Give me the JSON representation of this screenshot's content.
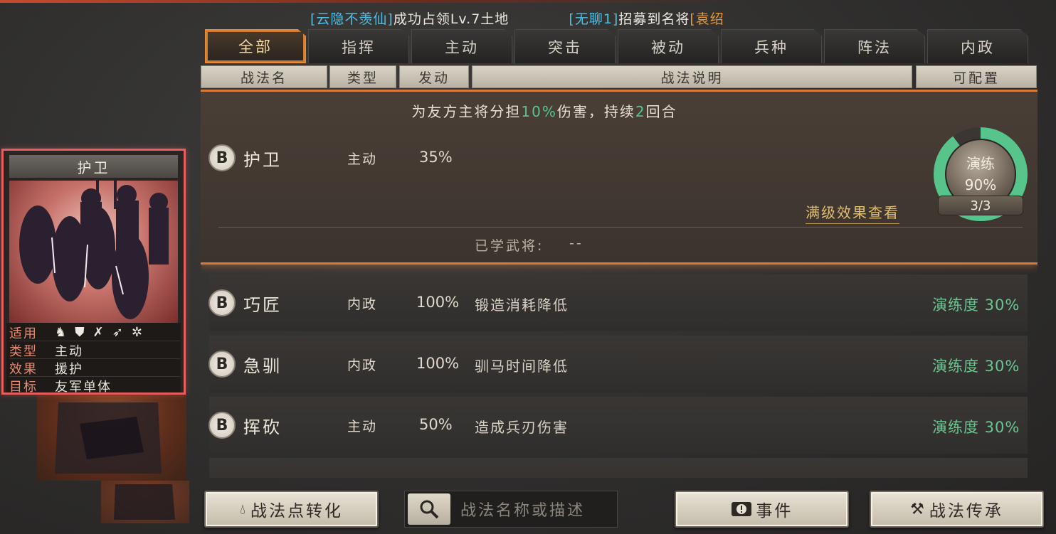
{
  "marquee": {
    "part1_name": "[云隐不羡仙]",
    "part1_text": "成功占领Lv.7土地",
    "part2_name": "[无聊1]",
    "part2_text": "招募到名将",
    "part2_hero": "[袁绍"
  },
  "tabs": [
    "全部",
    "指挥",
    "主动",
    "突击",
    "被动",
    "兵种",
    "阵法",
    "内政"
  ],
  "columns": {
    "name": "战法名",
    "type": "类型",
    "trigger": "发动",
    "desc": "战法说明",
    "configurable": "可配置"
  },
  "selected": {
    "grade": "B",
    "name": "护卫",
    "type": "主动",
    "trigger": "35%",
    "desc_pre": "为友方主将分担",
    "desc_pct": "10%",
    "desc_mid": "伤害，持续",
    "desc_num": "2",
    "desc_post": "回合",
    "full_effect_link": "满级效果查看",
    "learned_label": "已学武将:",
    "learned_value": "--",
    "train_label": "演练",
    "train_pct": "90%",
    "train_progress": 0.9,
    "train_count": "3/3"
  },
  "rows": [
    {
      "grade": "B",
      "name": "巧匠",
      "type": "内政",
      "trigger": "100%",
      "desc": "锻造消耗降低",
      "train": "演练度 30%"
    },
    {
      "grade": "B",
      "name": "急驯",
      "type": "内政",
      "trigger": "100%",
      "desc": "驯马时间降低",
      "train": "演练度 30%"
    },
    {
      "grade": "B",
      "name": "挥砍",
      "type": "主动",
      "trigger": "50%",
      "desc": "造成兵刃伤害",
      "train": "演练度 30%"
    }
  ],
  "card": {
    "title": "护卫",
    "suit_label": "适用",
    "troop_icons": [
      "cavalry-icon",
      "shield-icon",
      "bow-icon",
      "spear-icon",
      "wheel-icon"
    ],
    "type_label": "类型",
    "type_value": "主动",
    "effect_label": "效果",
    "effect_value": "援护",
    "target_label": "目标",
    "target_value": "友军单体"
  },
  "buttons": {
    "convert": "战法点转化",
    "events": "事件",
    "inherit": "战法传承"
  },
  "search": {
    "placeholder": "战法名称或描述"
  },
  "colors": {
    "accent": "#d77a3c",
    "train_green": "#57c48c",
    "card_border": "#e65e5e"
  }
}
